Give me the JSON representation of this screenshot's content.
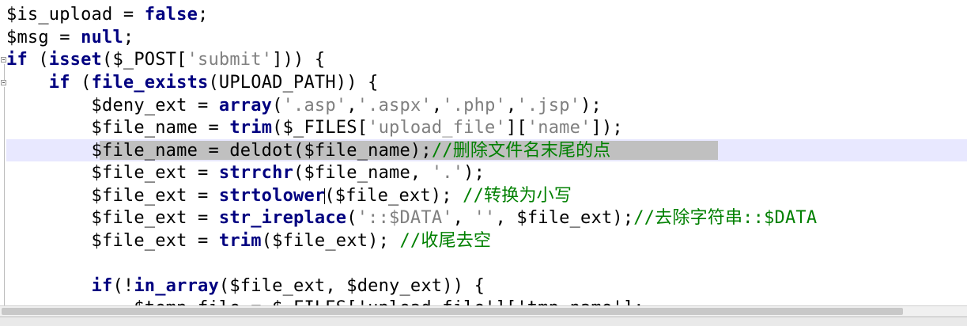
{
  "colors": {
    "keyword": "#000080",
    "string": "#808080",
    "comment": "#008000",
    "current_line": "#e8e8ff",
    "selection": "#c0c0c0"
  },
  "code": {
    "l0": {
      "a": "$is_upload = ",
      "b": "false",
      "c": ";"
    },
    "l1": {
      "a": "$msg = ",
      "b": "null",
      "c": ";"
    },
    "l2": {
      "a": "if",
      "b": " (",
      "c": "isset",
      "d": "($_POST[",
      "e": "'submit'",
      "f": "])) {"
    },
    "l3": {
      "a": "    ",
      "b": "if",
      "c": " (",
      "d": "file_exists",
      "e": "(UPLOAD_PATH)) {"
    },
    "l4": {
      "a": "        $deny_ext = ",
      "b": "array",
      "c": "(",
      "d": "'.asp'",
      "e": ",",
      "f": "'.aspx'",
      "g": ",",
      "h": "'.php'",
      "i": ",",
      "j": "'.jsp'",
      "k": ");"
    },
    "l5": {
      "a": "        $file_name = ",
      "b": "trim",
      "c": "($_FILES[",
      "d": "'upload_file'",
      "e": "][",
      "f": "'name'",
      "g": "]);"
    },
    "l6": {
      "a": "        ",
      "b": "$file_name = deldot($file_name);",
      "c": "//删除文件名末尾的点"
    },
    "l7": {
      "a": "        $file_ext = ",
      "b": "strrchr",
      "c": "($file_name, ",
      "d": "'.'",
      "e": ");"
    },
    "l8": {
      "a": "        $file_ext = ",
      "b": "strtolower",
      "c": "($file_ext); ",
      "d": "//转换为小写"
    },
    "l9": {
      "a": "        $file_ext = ",
      "b": "str_ireplace",
      "c": "(",
      "d": "'::$DATA'",
      "e": ", ",
      "f": "''",
      "g": ", $file_ext);",
      "h": "//去除字符串::$DATA"
    },
    "l10": {
      "a": "        $file_ext = ",
      "b": "trim",
      "c": "($file_ext); ",
      "d": "//收尾去空"
    },
    "l12": {
      "a": "        ",
      "b": "if",
      "c": "(!",
      "d": "in_array",
      "e": "($file_ext, $deny_ext)) {"
    },
    "l13": {
      "a": "            $temp_file = $_FILES['upload_file']['tmp_name'];"
    }
  }
}
